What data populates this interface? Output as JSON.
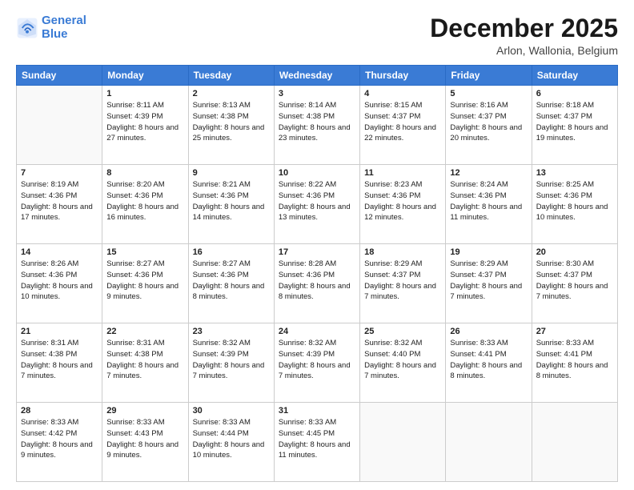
{
  "header": {
    "logo_line1": "General",
    "logo_line2": "Blue",
    "main_title": "December 2025",
    "subtitle": "Arlon, Wallonia, Belgium"
  },
  "calendar": {
    "weekdays": [
      "Sunday",
      "Monday",
      "Tuesday",
      "Wednesday",
      "Thursday",
      "Friday",
      "Saturday"
    ],
    "weeks": [
      [
        {
          "day": null
        },
        {
          "day": "1",
          "sunrise": "8:11 AM",
          "sunset": "4:39 PM",
          "daylight": "8 hours and 27 minutes."
        },
        {
          "day": "2",
          "sunrise": "8:13 AM",
          "sunset": "4:38 PM",
          "daylight": "8 hours and 25 minutes."
        },
        {
          "day": "3",
          "sunrise": "8:14 AM",
          "sunset": "4:38 PM",
          "daylight": "8 hours and 23 minutes."
        },
        {
          "day": "4",
          "sunrise": "8:15 AM",
          "sunset": "4:37 PM",
          "daylight": "8 hours and 22 minutes."
        },
        {
          "day": "5",
          "sunrise": "8:16 AM",
          "sunset": "4:37 PM",
          "daylight": "8 hours and 20 minutes."
        },
        {
          "day": "6",
          "sunrise": "8:18 AM",
          "sunset": "4:37 PM",
          "daylight": "8 hours and 19 minutes."
        }
      ],
      [
        {
          "day": "7",
          "sunrise": "8:19 AM",
          "sunset": "4:36 PM",
          "daylight": "8 hours and 17 minutes."
        },
        {
          "day": "8",
          "sunrise": "8:20 AM",
          "sunset": "4:36 PM",
          "daylight": "8 hours and 16 minutes."
        },
        {
          "day": "9",
          "sunrise": "8:21 AM",
          "sunset": "4:36 PM",
          "daylight": "8 hours and 14 minutes."
        },
        {
          "day": "10",
          "sunrise": "8:22 AM",
          "sunset": "4:36 PM",
          "daylight": "8 hours and 13 minutes."
        },
        {
          "day": "11",
          "sunrise": "8:23 AM",
          "sunset": "4:36 PM",
          "daylight": "8 hours and 12 minutes."
        },
        {
          "day": "12",
          "sunrise": "8:24 AM",
          "sunset": "4:36 PM",
          "daylight": "8 hours and 11 minutes."
        },
        {
          "day": "13",
          "sunrise": "8:25 AM",
          "sunset": "4:36 PM",
          "daylight": "8 hours and 10 minutes."
        }
      ],
      [
        {
          "day": "14",
          "sunrise": "8:26 AM",
          "sunset": "4:36 PM",
          "daylight": "8 hours and 10 minutes."
        },
        {
          "day": "15",
          "sunrise": "8:27 AM",
          "sunset": "4:36 PM",
          "daylight": "8 hours and 9 minutes."
        },
        {
          "day": "16",
          "sunrise": "8:27 AM",
          "sunset": "4:36 PM",
          "daylight": "8 hours and 8 minutes."
        },
        {
          "day": "17",
          "sunrise": "8:28 AM",
          "sunset": "4:36 PM",
          "daylight": "8 hours and 8 minutes."
        },
        {
          "day": "18",
          "sunrise": "8:29 AM",
          "sunset": "4:37 PM",
          "daylight": "8 hours and 7 minutes."
        },
        {
          "day": "19",
          "sunrise": "8:29 AM",
          "sunset": "4:37 PM",
          "daylight": "8 hours and 7 minutes."
        },
        {
          "day": "20",
          "sunrise": "8:30 AM",
          "sunset": "4:37 PM",
          "daylight": "8 hours and 7 minutes."
        }
      ],
      [
        {
          "day": "21",
          "sunrise": "8:31 AM",
          "sunset": "4:38 PM",
          "daylight": "8 hours and 7 minutes."
        },
        {
          "day": "22",
          "sunrise": "8:31 AM",
          "sunset": "4:38 PM",
          "daylight": "8 hours and 7 minutes."
        },
        {
          "day": "23",
          "sunrise": "8:32 AM",
          "sunset": "4:39 PM",
          "daylight": "8 hours and 7 minutes."
        },
        {
          "day": "24",
          "sunrise": "8:32 AM",
          "sunset": "4:39 PM",
          "daylight": "8 hours and 7 minutes."
        },
        {
          "day": "25",
          "sunrise": "8:32 AM",
          "sunset": "4:40 PM",
          "daylight": "8 hours and 7 minutes."
        },
        {
          "day": "26",
          "sunrise": "8:33 AM",
          "sunset": "4:41 PM",
          "daylight": "8 hours and 8 minutes."
        },
        {
          "day": "27",
          "sunrise": "8:33 AM",
          "sunset": "4:41 PM",
          "daylight": "8 hours and 8 minutes."
        }
      ],
      [
        {
          "day": "28",
          "sunrise": "8:33 AM",
          "sunset": "4:42 PM",
          "daylight": "8 hours and 9 minutes."
        },
        {
          "day": "29",
          "sunrise": "8:33 AM",
          "sunset": "4:43 PM",
          "daylight": "8 hours and 9 minutes."
        },
        {
          "day": "30",
          "sunrise": "8:33 AM",
          "sunset": "4:44 PM",
          "daylight": "8 hours and 10 minutes."
        },
        {
          "day": "31",
          "sunrise": "8:33 AM",
          "sunset": "4:45 PM",
          "daylight": "8 hours and 11 minutes."
        },
        {
          "day": null
        },
        {
          "day": null
        },
        {
          "day": null
        }
      ]
    ]
  }
}
